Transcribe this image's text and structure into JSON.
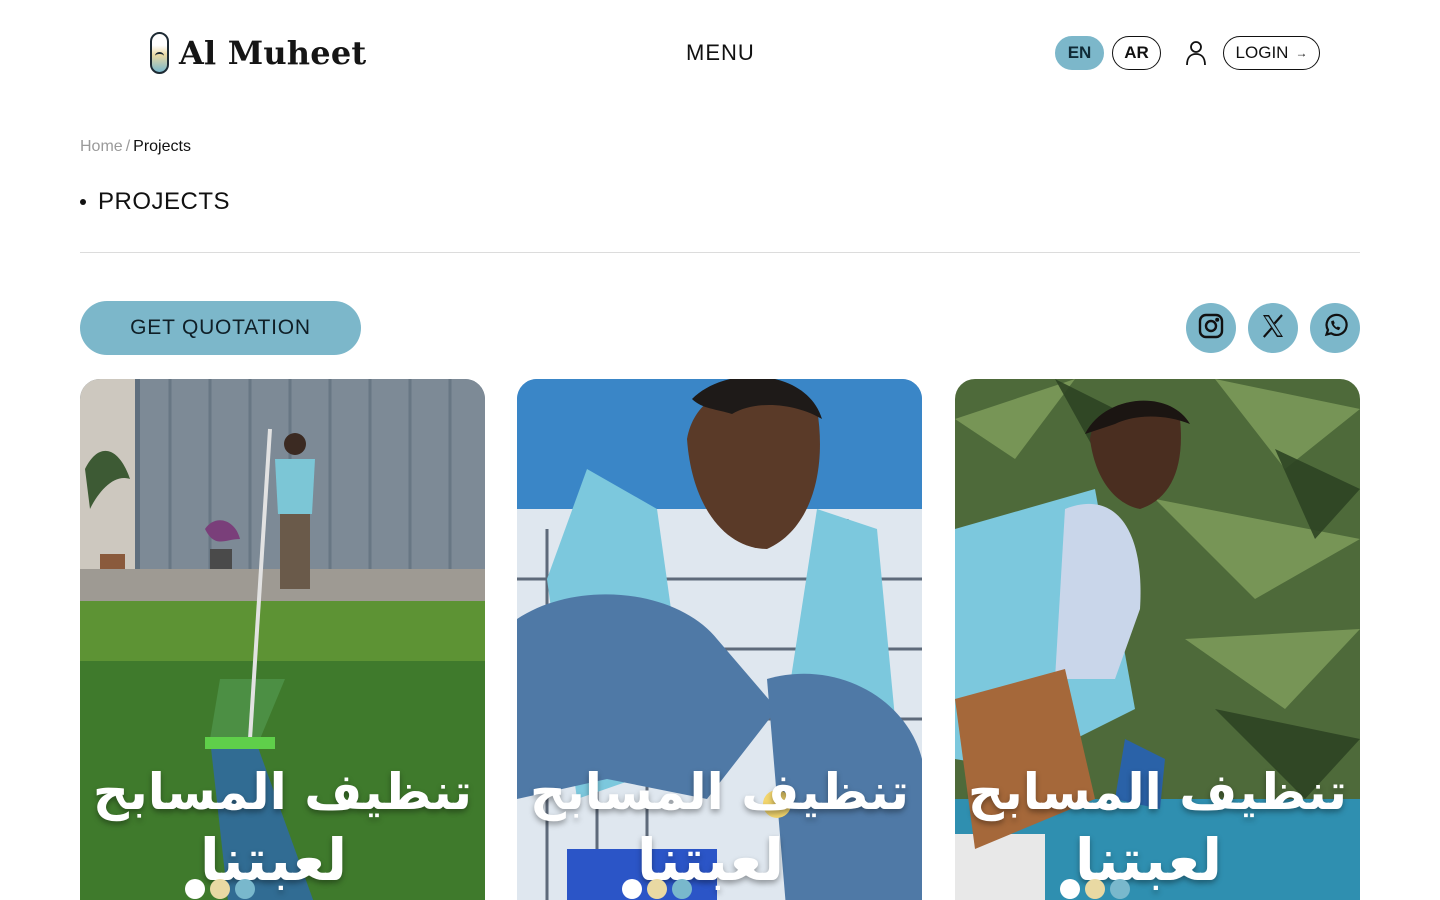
{
  "header": {
    "logo_text": "Al Muheet",
    "menu_label": "MENU",
    "lang_en": "EN",
    "lang_ar": "AR",
    "login_label": "LOGIN",
    "login_arrow": "→"
  },
  "breadcrumb": {
    "home": "Home",
    "separator": "/",
    "current": "Projects"
  },
  "page": {
    "title": "PROJECTS"
  },
  "actions": {
    "quotation_label": "GET QUOTATION",
    "social_icons": [
      "instagram-icon",
      "x-icon",
      "whatsapp-icon"
    ]
  },
  "cards": [
    {
      "line1": "تنظيف المسابح",
      "line2": "لعبتنا"
    },
    {
      "line1": "تنظيف المسابح",
      "line2": "لعبتنا"
    },
    {
      "line1": "تنظيف المسابح",
      "line2": "لعبتنا"
    }
  ],
  "colors": {
    "accent": "#7cb7ca",
    "text": "#111111",
    "muted": "#9a9a9a",
    "dot_white": "#ffffff",
    "dot_sand": "#e9d9a3",
    "dot_blue": "#79b8cc"
  }
}
